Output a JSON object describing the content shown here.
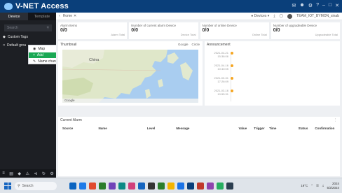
{
  "app": {
    "title": "V-NET Access"
  },
  "sidebar": {
    "tabs": [
      {
        "label": "Device",
        "active": true
      },
      {
        "label": "Template",
        "active": false
      }
    ],
    "search_placeholder": "Search",
    "items": [
      {
        "label": "Custom Tags",
        "icon": "tag-icon"
      },
      {
        "label": "Default grou",
        "icon": "folder-icon"
      }
    ],
    "bottom_icons": [
      "menu-icon",
      "list-icon",
      "tag-icon",
      "alarm-icon",
      "share-icon",
      "refresh-icon",
      "settings-icon"
    ]
  },
  "context_menu": {
    "items": [
      {
        "label": "Map",
        "selected": false
      },
      {
        "label": "Add",
        "selected": true
      },
      {
        "label": "Name change",
        "selected": false
      }
    ]
  },
  "topbar": {
    "home_label": "Home",
    "devices_label": "Devices",
    "user_label": "TEAM_IOT_BYMON_sinab"
  },
  "stats": [
    {
      "label": "Alarm Items",
      "value": "0/0",
      "sub": "Alarm Total"
    },
    {
      "label": "Number of current alarm Device",
      "value": "0/0",
      "sub": "Device Total"
    },
    {
      "label": "Number of online Device",
      "value": "0/0",
      "sub": "Online Total"
    },
    {
      "label": "Number of upgradeable Device",
      "value": "0/0",
      "sub": "Upgradeable Total"
    }
  ],
  "map_panel": {
    "title": "Thumbnail",
    "controls": [
      "Google",
      "Circle"
    ],
    "labels": {
      "country": "China",
      "footer_brand": "Google"
    }
  },
  "announcement": {
    "title": "Announcement",
    "items": [
      {
        "date": "2021-04-21",
        "time": "15:38:06"
      },
      {
        "date": "2021-04-16",
        "time": "10:40:05"
      },
      {
        "date": "2021-03-31",
        "time": "17:26:09"
      },
      {
        "date": "2021-03-16",
        "time": "10:55:31"
      }
    ]
  },
  "alarm": {
    "title": "Current Alarm",
    "columns": [
      "Source",
      "Name",
      "Level",
      "Message",
      "Value",
      "Trigger",
      "Time",
      "Status",
      "Confirmation"
    ],
    "rows": []
  },
  "taskbar": {
    "search_label": "Search",
    "time": "2024",
    "date": "5/2/2024",
    "temp": "19°C",
    "app_colors": [
      "#0b64c0",
      "#1f7be8",
      "#e04a2f",
      "#2b7d2b",
      "#7043b8",
      "#0e8a86",
      "#d23f7a",
      "#1565c0",
      "#333333",
      "#2b7d2b",
      "#f4b400",
      "#1a73e8",
      "#0a3f7a",
      "#c0392b",
      "#8e44ad",
      "#27ae60",
      "#2c3e50"
    ]
  }
}
